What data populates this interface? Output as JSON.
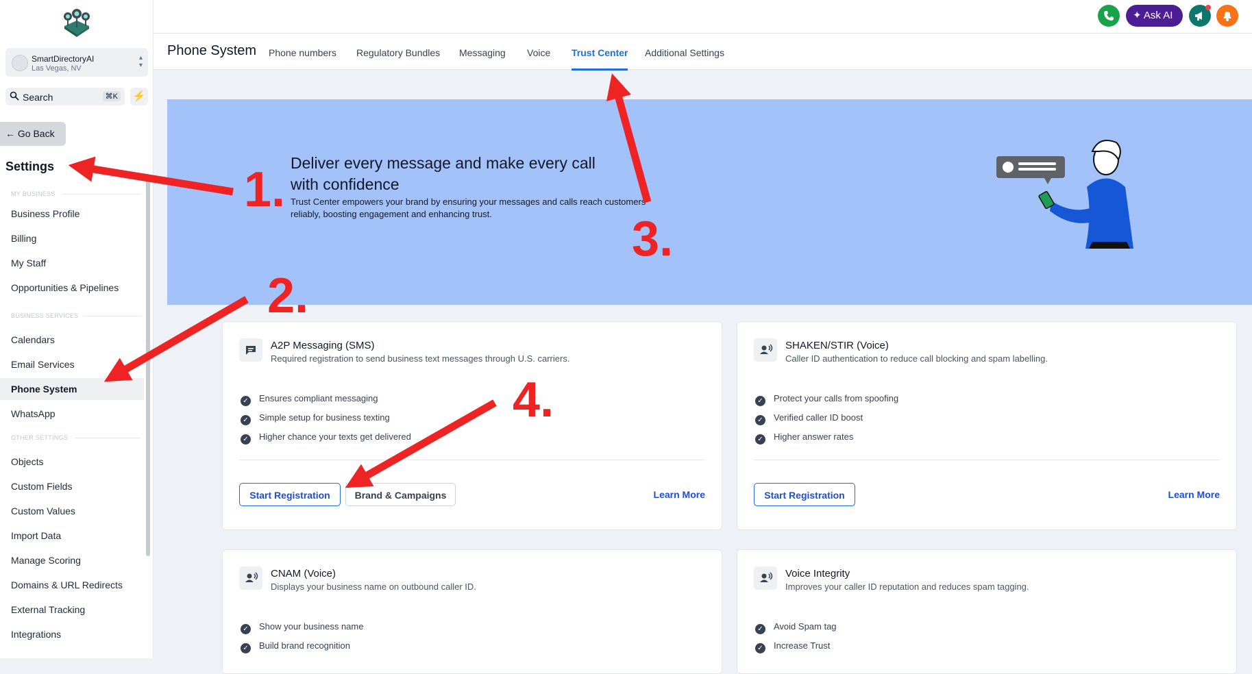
{
  "sidebar": {
    "account": {
      "name": "SmartDirectoryAI",
      "location": "Las Vegas, NV"
    },
    "search": {
      "label": "Search",
      "shortcut": "⌘K"
    },
    "go_back": "Go Back",
    "title": "Settings",
    "sections": {
      "my_business": "MY BUSINESS",
      "business_services": "BUSINESS SERVICES",
      "other_settings": "OTHER SETTINGS"
    },
    "items": [
      "Business Profile",
      "Billing",
      "My Staff",
      "Opportunities & Pipelines",
      "Calendars",
      "Email Services",
      "Phone System",
      "WhatsApp",
      "Objects",
      "Custom Fields",
      "Custom Values",
      "Import Data",
      "Manage Scoring",
      "Domains & URL Redirects",
      "External Tracking",
      "Integrations"
    ],
    "active_item": "Phone System"
  },
  "topbar": {
    "ask_ai": "Ask AI",
    "colors": {
      "phone": "#16a34a",
      "ask_ai": "#4c1d95",
      "megaphone": "#0f766e",
      "bell": "#f97316"
    }
  },
  "subnav": {
    "title": "Phone System",
    "tabs": [
      "Phone numbers",
      "Regulatory Bundles",
      "Messaging",
      "Voice",
      "Trust Center",
      "Additional Settings"
    ],
    "active_tab": "Trust Center"
  },
  "hero": {
    "heading": "Deliver every message and make every call with confidence",
    "text": "Trust Center empowers your brand by ensuring your messages and calls reach customers reliably, boosting engagement and enhancing trust."
  },
  "cards": [
    {
      "title": "A2P Messaging (SMS)",
      "description": "Required registration to send business text messages through U.S. carriers.",
      "features": [
        "Ensures compliant messaging",
        "Simple setup for business texting",
        "Higher chance your texts get delivered"
      ],
      "primary": "Start Registration",
      "secondary": "Brand & Campaigns",
      "learn_more": "Learn More"
    },
    {
      "title": "SHAKEN/STIR (Voice)",
      "description": "Caller ID authentication to reduce call blocking and spam labelling.",
      "features": [
        "Protect your calls from spoofing",
        "Verified caller ID boost",
        "Higher answer rates"
      ],
      "primary": "Start Registration",
      "learn_more": "Learn More"
    },
    {
      "title": "CNAM (Voice)",
      "description": "Displays your business name on outbound caller ID.",
      "features": [
        "Show your business name",
        "Build brand recognition"
      ]
    },
    {
      "title": "Voice Integrity",
      "description": "Improves your caller ID reputation and reduces spam tagging.",
      "features": [
        "Avoid Spam tag",
        "Increase Trust"
      ]
    }
  ],
  "annotations": {
    "n1": "1.",
    "n2": "2.",
    "n3": "3.",
    "n4": "4.",
    "color": "#ee2424"
  }
}
